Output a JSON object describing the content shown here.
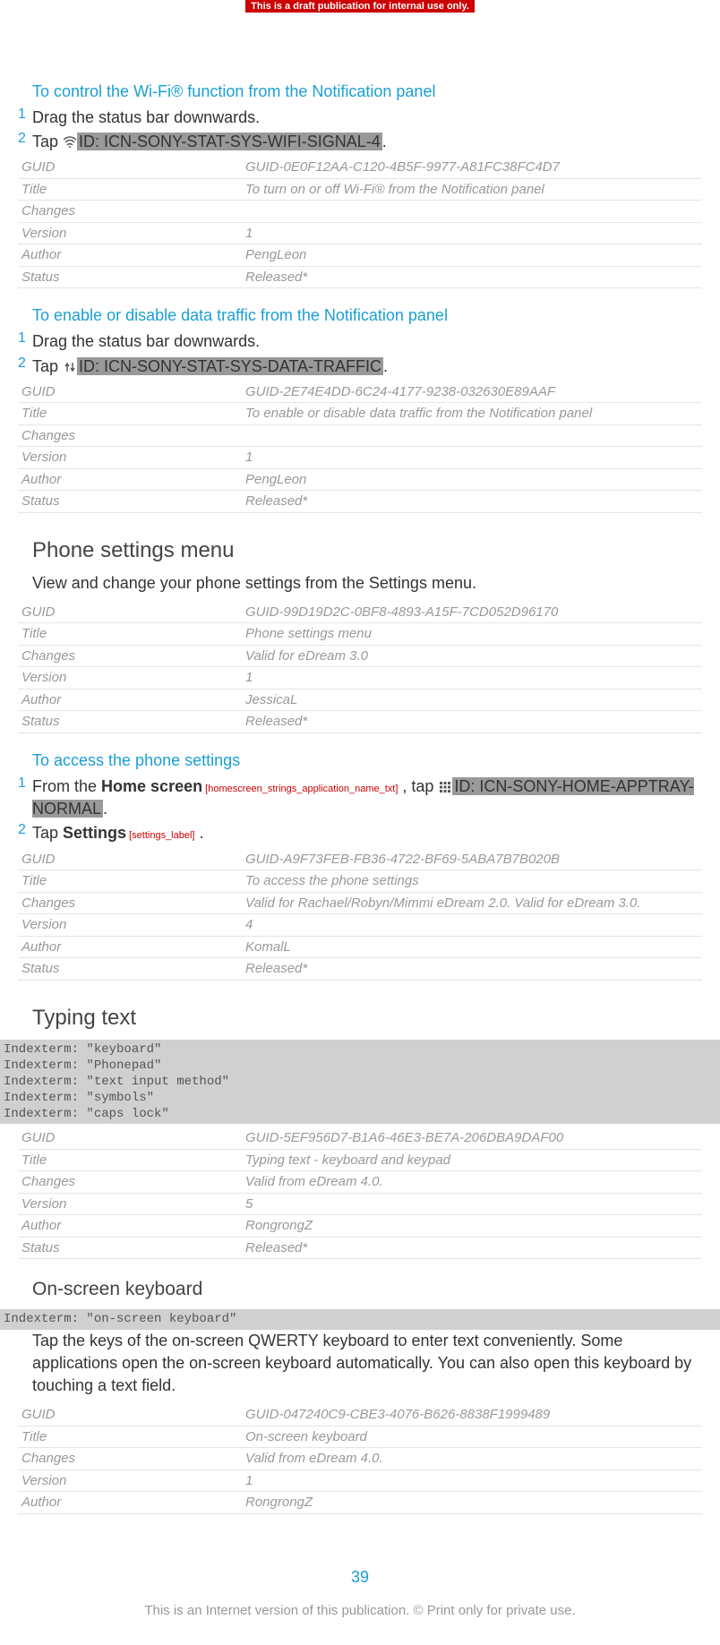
{
  "draftBanner": "This is a draft publication for internal use only.",
  "s1": {
    "heading": "To control the Wi-Fi® function from the Notification panel",
    "step1num": "1",
    "step1": "Drag the status bar downwards.",
    "step2num": "2",
    "step2pre": "Tap ",
    "step2icn": "ID: ICN-SONY-STAT-SYS-WIFI-SIGNAL-4",
    "step2post": ".",
    "meta": {
      "guidLabel": "GUID",
      "guid": "GUID-0E0F12AA-C120-4B5F-9977-A81FC38FC4D7",
      "titleLabel": "Title",
      "title": "To turn on or off Wi-Fi® from the Notification panel",
      "changesLabel": "Changes",
      "changes": "",
      "versionLabel": "Version",
      "version": "1",
      "authorLabel": "Author",
      "author": "PengLeon",
      "statusLabel": "Status",
      "status": "Released*"
    }
  },
  "s2": {
    "heading": "To enable or disable data traffic from the Notification panel",
    "step1num": "1",
    "step1": "Drag the status bar downwards.",
    "step2num": "2",
    "step2pre": "Tap ",
    "step2icn": "ID: ICN-SONY-STAT-SYS-DATA-TRAFFIC",
    "step2post": ".",
    "meta": {
      "guidLabel": "GUID",
      "guid": "GUID-2E74E4DD-6C24-4177-9238-032630E89AAF",
      "titleLabel": "Title",
      "title": "To enable or disable data traffic from the Notification panel",
      "changesLabel": "Changes",
      "changes": "",
      "versionLabel": "Version",
      "version": "1",
      "authorLabel": "Author",
      "author": "PengLeon",
      "statusLabel": "Status",
      "status": "Released*"
    }
  },
  "s3": {
    "heading": "Phone settings menu",
    "desc": "View and change your phone settings from the Settings menu.",
    "meta": {
      "guidLabel": "GUID",
      "guid": "GUID-99D19D2C-0BF8-4893-A15F-7CD052D96170",
      "titleLabel": "Title",
      "title": "Phone settings menu",
      "changesLabel": "Changes",
      "changes": "Valid for eDream 3.0",
      "versionLabel": "Version",
      "version": "1",
      "authorLabel": "Author",
      "author": "JessicaL",
      "statusLabel": "Status",
      "status": "Released*"
    }
  },
  "s4": {
    "heading": "To access the phone settings",
    "step1num": "1",
    "step1pre": "From the ",
    "step1bold": "Home screen",
    "step1label": " [homescreen_strings_application_name_txt]",
    "step1mid": " , tap ",
    "step1icn": "ID: ICN-SONY-HOME-APPTRAY-NORMAL",
    "step1post": ".",
    "step2num": "2",
    "step2pre": "Tap ",
    "step2bold": "Settings",
    "step2label": " [settings_label]",
    "step2post": " .",
    "meta": {
      "guidLabel": "GUID",
      "guid": "GUID-A9F73FEB-FB36-4722-BF69-5ABA7B7B020B",
      "titleLabel": "Title",
      "title": "To access the phone settings",
      "changesLabel": "Changes",
      "changes": "Valid for Rachael/Robyn/Mimmi eDream 2.0. Valid for eDream 3.0.",
      "versionLabel": "Version",
      "version": "4",
      "authorLabel": "Author",
      "author": "KomalL",
      "statusLabel": "Status",
      "status": "Released*"
    }
  },
  "s5": {
    "heading": "Typing text",
    "indexterms": "Indexterm: \"keyboard\"\nIndexterm: \"Phonepad\"\nIndexterm: \"text input method\"\nIndexterm: \"symbols\"\nIndexterm: \"caps lock\"",
    "meta": {
      "guidLabel": "GUID",
      "guid": "GUID-5EF956D7-B1A6-46E3-BE7A-206DBA9DAF00",
      "titleLabel": "Title",
      "title": "Typing text - keyboard and keypad",
      "changesLabel": "Changes",
      "changes": "Valid from eDream 4.0.",
      "versionLabel": "Version",
      "version": "5",
      "authorLabel": "Author",
      "author": "RongrongZ",
      "statusLabel": "Status",
      "status": "Released*"
    }
  },
  "s6": {
    "heading": "On-screen keyboard",
    "indexterms": "Indexterm: \"on-screen keyboard\"",
    "desc": "Tap the keys of the on-screen QWERTY keyboard to enter text conveniently. Some applications open the on-screen keyboard automatically. You can also open this keyboard by touching a text field.",
    "meta": {
      "guidLabel": "GUID",
      "guid": "GUID-047240C9-CBE3-4076-B626-8838F1999489",
      "titleLabel": "Title",
      "title": "On-screen keyboard",
      "changesLabel": "Changes",
      "changes": "Valid from eDream 4.0.",
      "versionLabel": "Version",
      "version": "1",
      "authorLabel": "Author",
      "author": "RongrongZ"
    }
  },
  "pageNum": "39",
  "footer": "This is an Internet version of this publication. © Print only for private use."
}
